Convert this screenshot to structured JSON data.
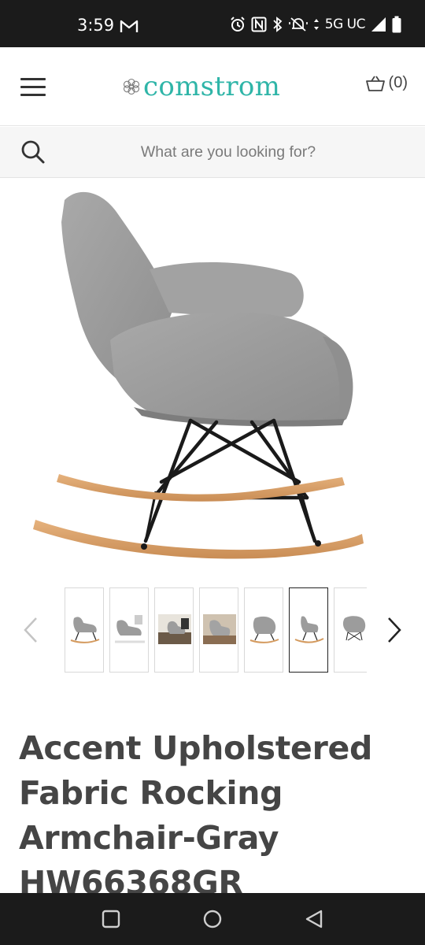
{
  "status_bar": {
    "time": "3:59",
    "network": "5G UC",
    "icons": [
      "gmail-icon",
      "alarm-icon",
      "nfc-icon",
      "bluetooth-icon",
      "mute-icon",
      "data-arrows-icon",
      "signal-icon",
      "battery-icon"
    ]
  },
  "header": {
    "brand": "comstrom",
    "cart_count": "(0)",
    "accent_color": "#2fb5a8"
  },
  "search": {
    "placeholder": "What are you looking for?"
  },
  "product": {
    "title": "Accent Upholstered Fabric Rocking Armchair-Gray HW66368GR",
    "image_alt": "Gray fabric rocking armchair with black metal legs and wooden rockers",
    "selected_thumbnail": 6,
    "thumbnails": [
      "chair-side",
      "chair-room",
      "chair-lounge",
      "chair-living",
      "chair-angle",
      "chair-profile",
      "chair-front"
    ]
  },
  "nav_bar": {
    "buttons": [
      "recents-button",
      "home-button",
      "back-button"
    ]
  }
}
